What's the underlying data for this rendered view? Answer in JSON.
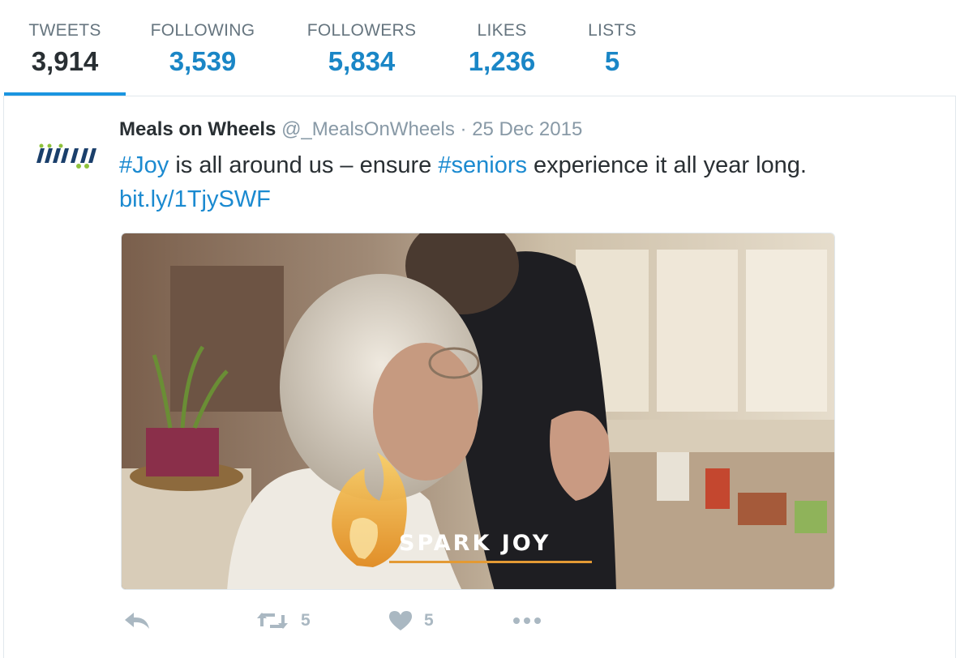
{
  "profile_stats": {
    "tweets": {
      "label": "TWEETS",
      "value": "3,914"
    },
    "following": {
      "label": "FOLLOWING",
      "value": "3,539"
    },
    "followers": {
      "label": "FOLLOWERS",
      "value": "5,834"
    },
    "likes": {
      "label": "LIKES",
      "value": "1,236"
    },
    "lists": {
      "label": "LISTS",
      "value": "5"
    },
    "active_tab": "tweets"
  },
  "tweet": {
    "author_name": "Meals on Wheels",
    "author_handle": "@_MealsOnWheels",
    "separator": "·",
    "date": "25 Dec 2015",
    "text_parts": {
      "hashtag1": "#Joy",
      "t1": " is all around us – ensure ",
      "hashtag2": "#seniors",
      "t2": " experience it all year long.",
      "link": "bit.ly/1TjySWF"
    },
    "media": {
      "overlay_text": "SPARK JOY",
      "logo_mark": "MOW"
    },
    "actions": {
      "reply_icon": "reply-icon",
      "retweet_icon": "retweet-icon",
      "retweet_count": "5",
      "like_icon": "heart-icon",
      "like_count": "5",
      "more_icon": "more-icon"
    }
  },
  "colors": {
    "link_blue": "#1b95e0",
    "text_dark": "#292f33",
    "text_gray": "#8899a6",
    "action_gray": "#aab8c2"
  }
}
